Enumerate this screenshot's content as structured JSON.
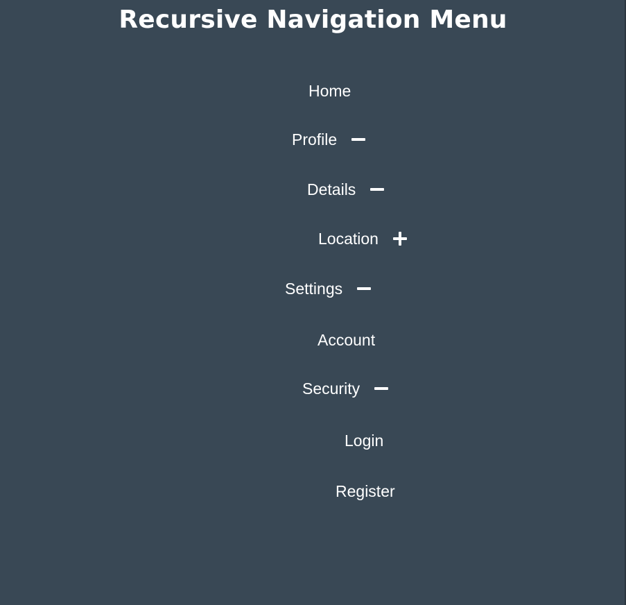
{
  "page": {
    "title": "Recursive Navigation Menu"
  },
  "colors": {
    "background": "#394855",
    "text": "#ffffff"
  },
  "menu": {
    "home": {
      "label": "Home"
    },
    "profile": {
      "label": "Profile",
      "expanded": true,
      "toggle_icon": "minus-icon",
      "children": {
        "details": {
          "label": "Details",
          "expanded": true,
          "toggle_icon": "minus-icon",
          "children": {
            "location": {
              "label": "Location",
              "expanded": false,
              "toggle_icon": "plus-icon"
            }
          }
        }
      }
    },
    "settings": {
      "label": "Settings",
      "expanded": true,
      "toggle_icon": "minus-icon",
      "children": {
        "account": {
          "label": "Account"
        },
        "security": {
          "label": "Security",
          "expanded": true,
          "toggle_icon": "minus-icon",
          "children": {
            "login": {
              "label": "Login"
            },
            "register": {
              "label": "Register"
            }
          }
        }
      }
    }
  }
}
